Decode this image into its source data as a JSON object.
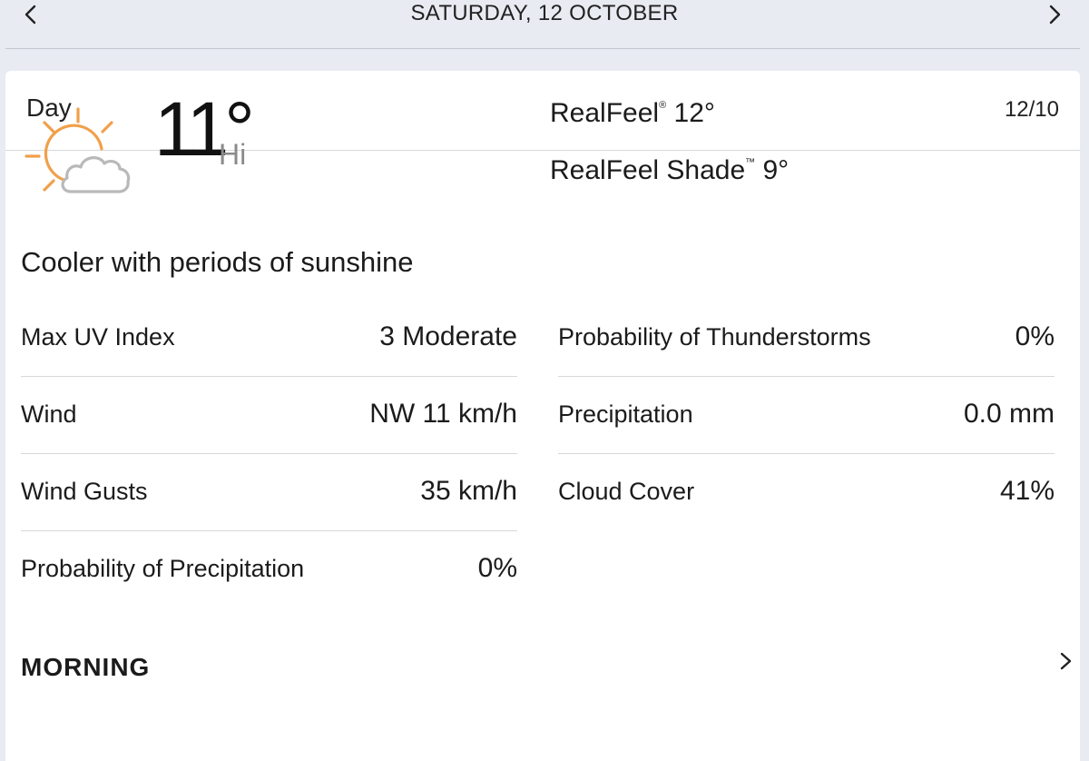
{
  "nav": {
    "date_title": "SATURDAY, 12 OCTOBER",
    "prev_icon": "chevron-left-icon",
    "next_icon": "chevron-right-icon"
  },
  "card": {
    "label": "Day",
    "date_short": "12/10"
  },
  "current": {
    "icon": "partly-sunny-icon",
    "temp": "11°",
    "temp_suffix": "Hi",
    "realfeel_label": "RealFeel",
    "realfeel_mark": "®",
    "realfeel_value": "12°",
    "realfeel_shade_label": "RealFeel Shade",
    "realfeel_shade_mark": "™",
    "realfeel_shade_value": "9°",
    "phrase": "Cooler with periods of sunshine"
  },
  "details_left": [
    {
      "label": "Max UV Index",
      "value": "3 Moderate"
    },
    {
      "label": "Wind",
      "value": "NW 11 km/h"
    },
    {
      "label": "Wind Gusts",
      "value": "35 km/h"
    },
    {
      "label": "Probability of Precipitation",
      "value": "0%"
    }
  ],
  "details_right": [
    {
      "label": "Probability of Thunderstorms",
      "value": "0%"
    },
    {
      "label": "Precipitation",
      "value": "0.0 mm"
    },
    {
      "label": "Cloud Cover",
      "value": "41%"
    }
  ],
  "next_section": {
    "label": "MORNING"
  },
  "colors": {
    "background": "#e8ebf2",
    "card": "#ffffff",
    "sun": "#f0a04b",
    "cloud_stroke": "#b9b9b9",
    "divider": "#d6d8dc",
    "muted_text": "#8a8a8a"
  }
}
